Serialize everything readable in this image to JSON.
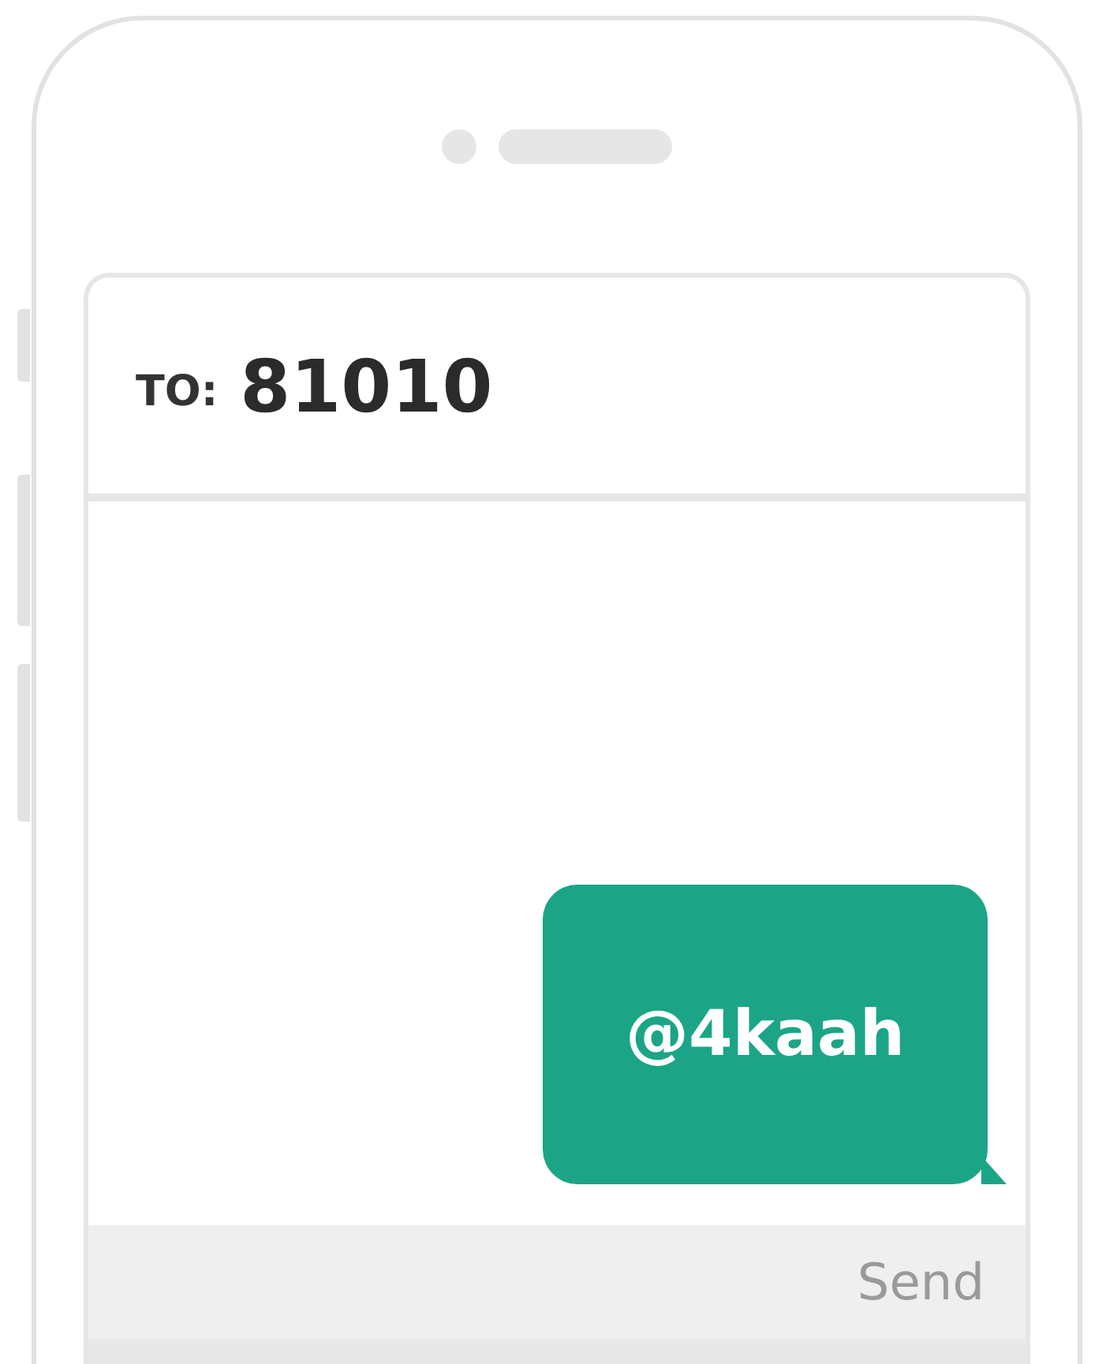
{
  "compose": {
    "recipient_label": "TO:",
    "recipient": "81010",
    "message": "@4kaah",
    "send_button": "Send"
  }
}
